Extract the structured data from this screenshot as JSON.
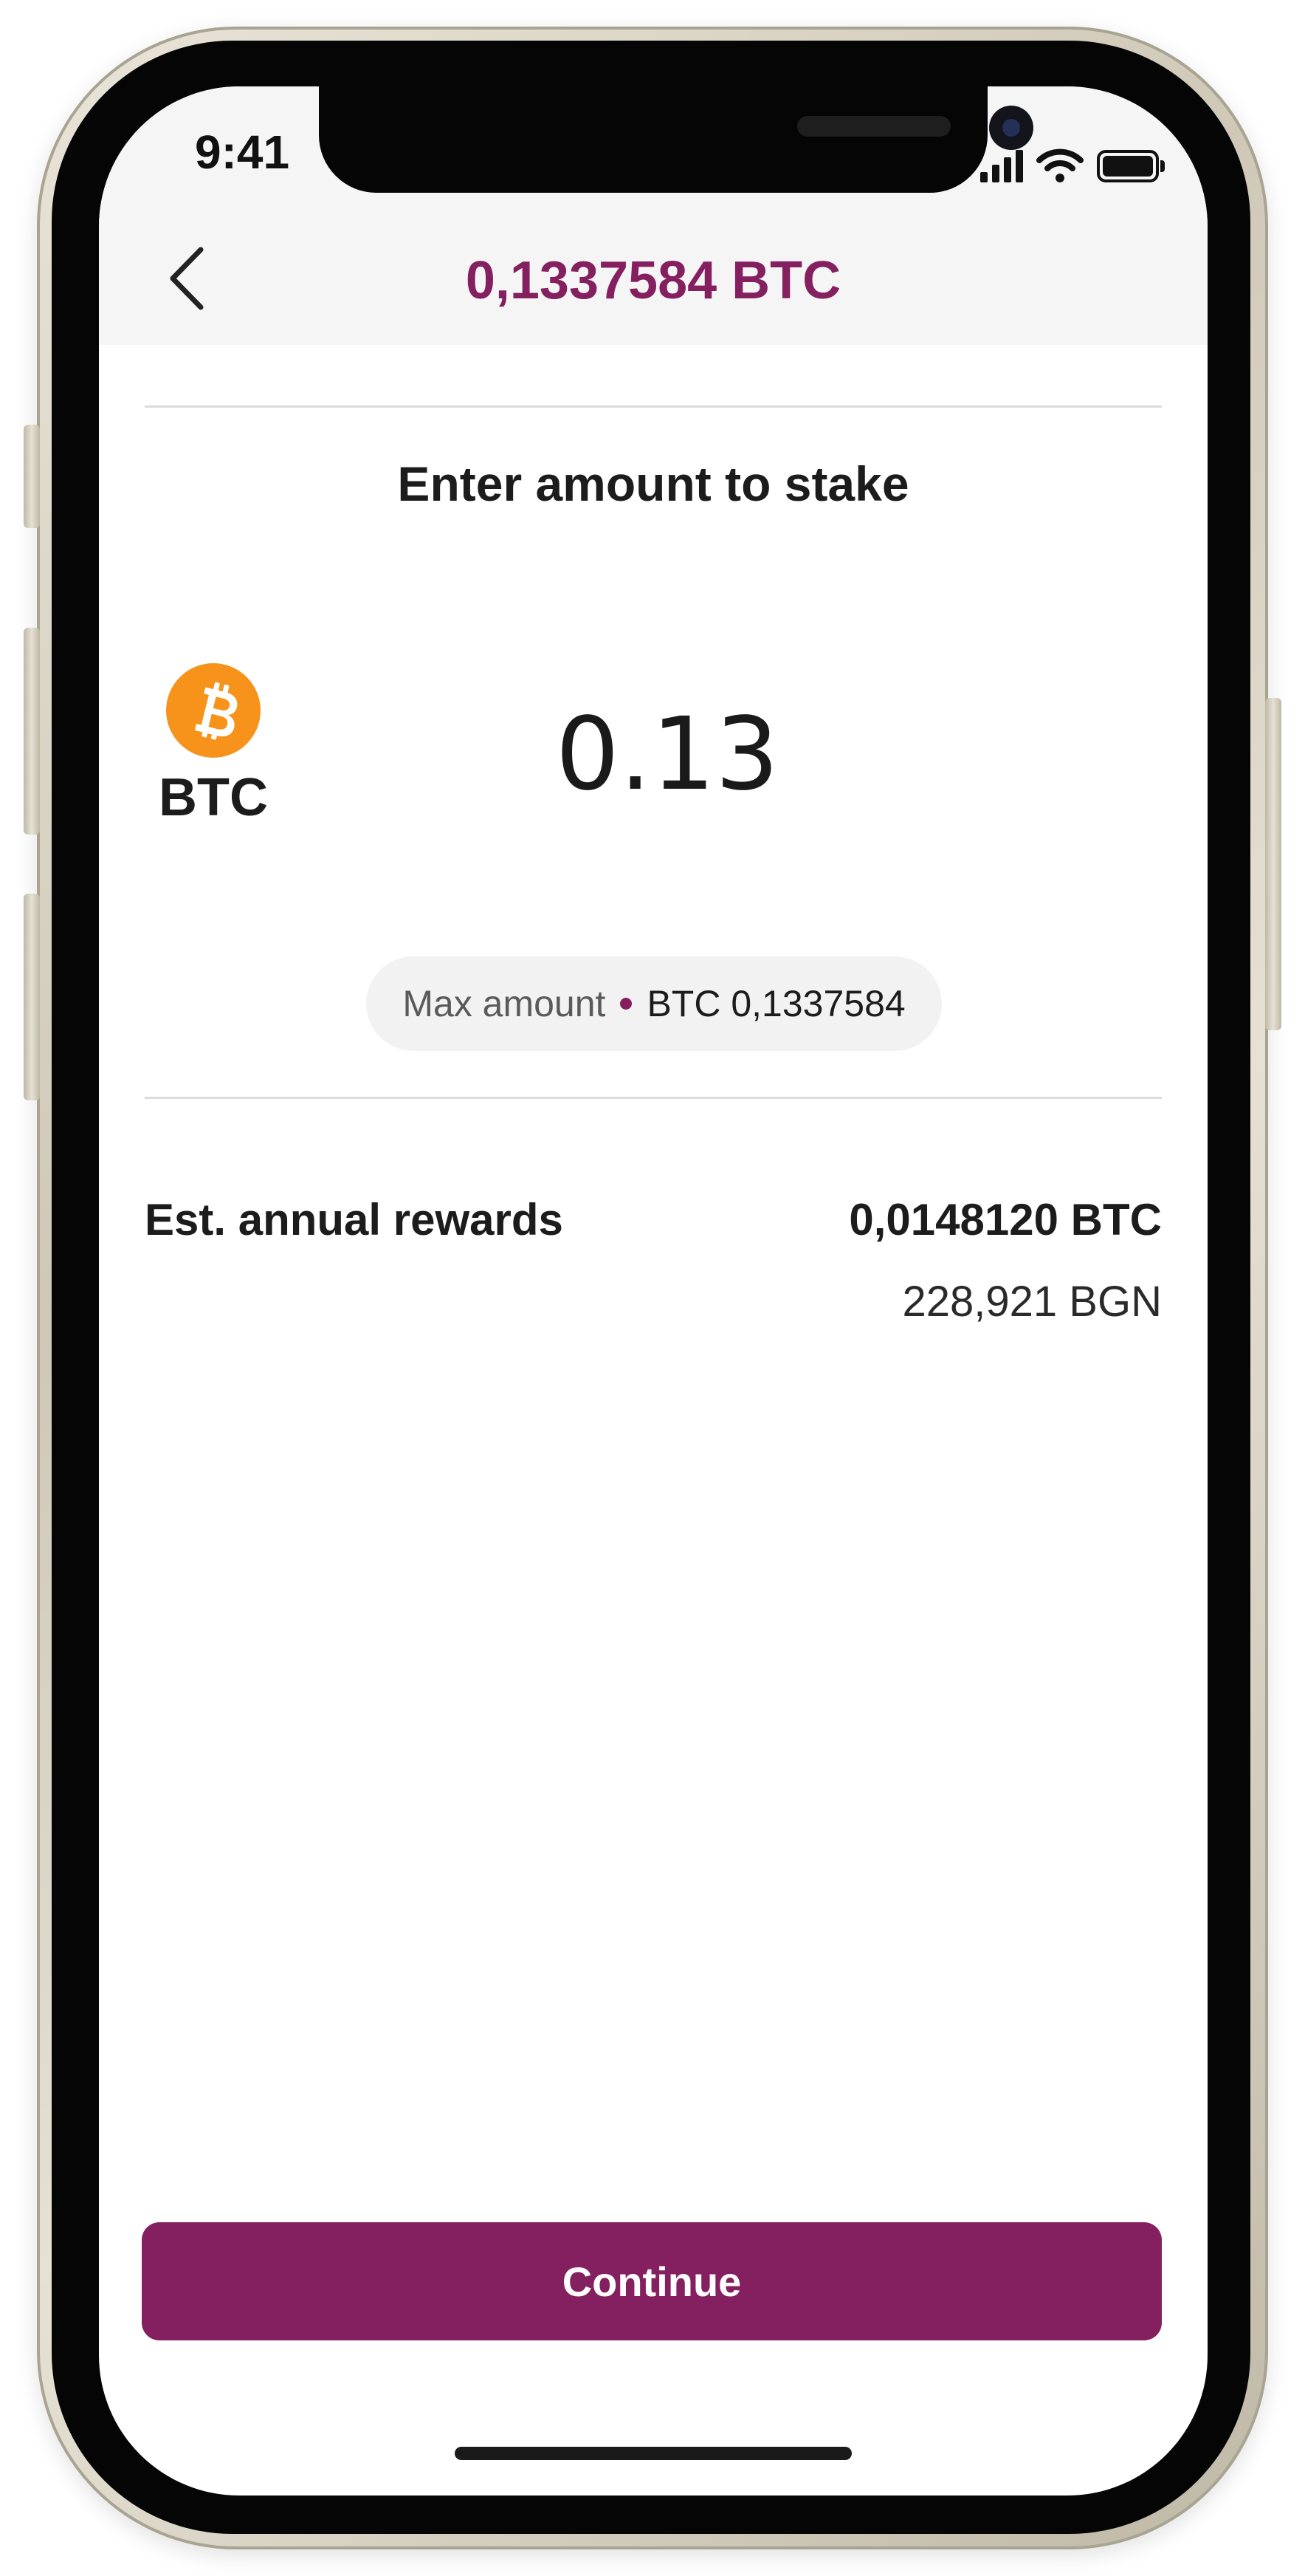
{
  "status_bar": {
    "time": "9:41",
    "icons": [
      "signal-icon",
      "wifi-icon",
      "battery-icon"
    ]
  },
  "header": {
    "back_icon": "chevron-left-icon",
    "title": "0,1337584 BTC"
  },
  "stake": {
    "title": "Enter amount to stake",
    "coin_icon": "bitcoin-icon",
    "coin_symbol": "BTC",
    "amount_value": "0.13",
    "max_label": "Max amount",
    "max_value": "BTC 0,1337584"
  },
  "rewards": {
    "label": "Est. annual rewards",
    "crypto_value": "0,0148120 BTC",
    "fiat_value": "228,921 BGN"
  },
  "actions": {
    "continue_label": "Continue"
  },
  "colors": {
    "accent": "#84205f",
    "bitcoin": "#f7931a",
    "header_bg": "#f5f5f5",
    "divider": "#dcdcdc"
  }
}
